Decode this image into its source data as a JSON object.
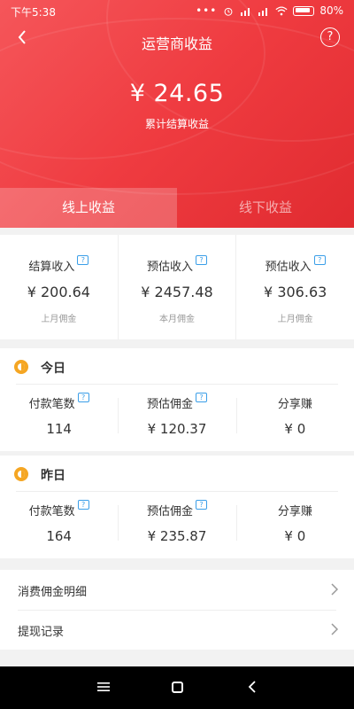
{
  "status_bar": {
    "time": "下午5:38",
    "battery": "80%"
  },
  "header": {
    "title": "运营商收益",
    "help": "?"
  },
  "total": {
    "amount": "¥ 24.65",
    "label": "累计结算收益"
  },
  "tabs": [
    {
      "label": "线上收益",
      "active": true
    },
    {
      "label": "线下收益",
      "active": false
    }
  ],
  "summary": [
    {
      "label": "结算收入",
      "value": "¥ 200.64",
      "sub": "上月佣金"
    },
    {
      "label": "预估收入",
      "value": "¥ 2457.48",
      "sub": "本月佣金"
    },
    {
      "label": "预估收入",
      "value": "¥ 306.63",
      "sub": "上月佣金"
    }
  ],
  "today": {
    "title": "今日",
    "stats": [
      {
        "label": "付款笔数",
        "value": "114"
      },
      {
        "label": "预估佣金",
        "value": "¥ 120.37"
      },
      {
        "label": "分享赚",
        "value": "¥ 0"
      }
    ]
  },
  "yesterday": {
    "title": "昨日",
    "stats": [
      {
        "label": "付款笔数",
        "value": "164"
      },
      {
        "label": "预估佣金",
        "value": "¥ 235.87"
      },
      {
        "label": "分享赚",
        "value": "¥ 0"
      }
    ]
  },
  "list": [
    {
      "label": "消费佣金明细"
    },
    {
      "label": "提现记录"
    }
  ],
  "colors": {
    "brand_red": "#ef3b40",
    "info_blue": "#3a9ee8",
    "sun_orange": "#f5a623"
  }
}
